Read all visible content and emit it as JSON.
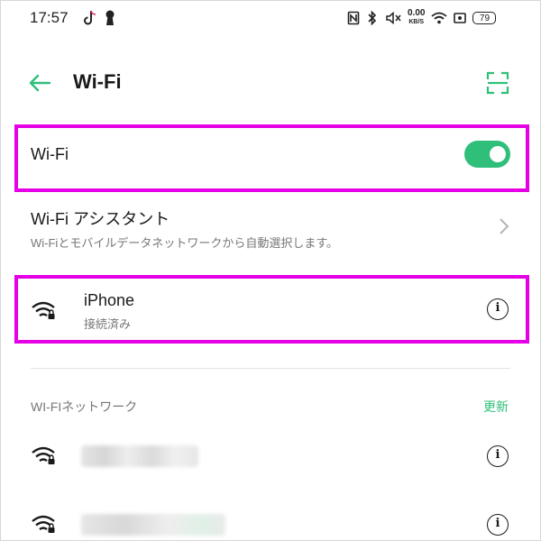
{
  "status_bar": {
    "time": "17:57",
    "net_speed": "0.00",
    "net_unit": "KB/S",
    "battery": "79"
  },
  "header": {
    "title": "Wi-Fi"
  },
  "wifi_toggle": {
    "label": "Wi-Fi",
    "state": "on"
  },
  "assistant": {
    "title": "Wi-Fi アシスタント",
    "subtitle": "Wi-Fiとモバイルデータネットワークから自動選択します。"
  },
  "connected": {
    "name": "iPhone",
    "status": "接続済み"
  },
  "networks": {
    "section_title": "WI-FIネットワーク",
    "refresh_label": "更新"
  },
  "colors": {
    "accent": "#2fbf7a",
    "highlight": "#e600e6"
  }
}
